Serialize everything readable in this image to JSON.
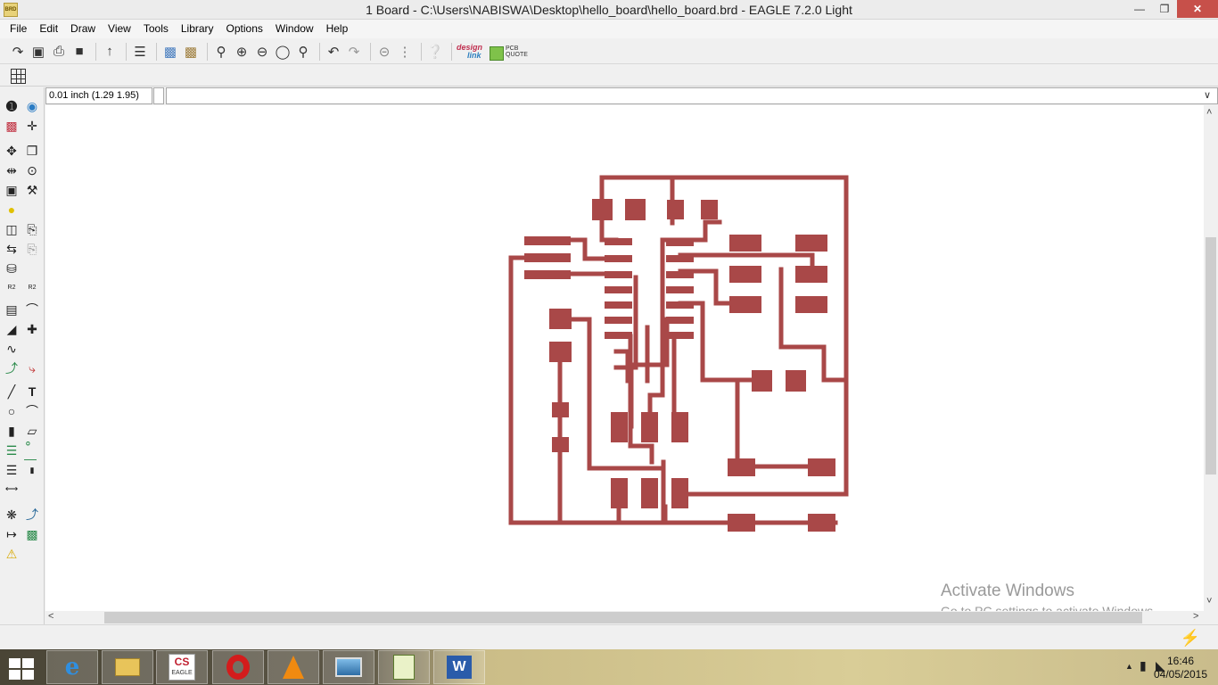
{
  "window": {
    "app_icon": "BRD",
    "title": "1 Board - C:\\Users\\NABISWA\\Desktop\\hello_board\\hello_board.brd - EAGLE 7.2.0 Light",
    "minimize": "minimize-icon",
    "restore": "restore-icon",
    "close": "close-icon"
  },
  "menu": {
    "items": [
      "File",
      "Edit",
      "Draw",
      "View",
      "Tools",
      "Library",
      "Options",
      "Window",
      "Help"
    ]
  },
  "toolbar": {
    "icons": [
      "open-icon",
      "save-icon",
      "print-icon",
      "cam-icon",
      "script-icon",
      "ulp-icon",
      "schematic-icon",
      "board-icon",
      "zoom-fit-icon",
      "zoom-in-icon",
      "zoom-out-icon",
      "zoom-redraw-icon",
      "zoom-select-icon",
      "undo-icon",
      "redo-icon",
      "stop-icon",
      "go-icon",
      "help-icon"
    ],
    "design_link_top": "design",
    "design_link_bottom": "link",
    "pcb_quote": "PCB QUOTE"
  },
  "coords": {
    "readout": "0.01 inch (1.29 1.95)",
    "command_value": "",
    "command_placeholder": ""
  },
  "left_tools": [
    "info-icon",
    "show-icon",
    "display-icon",
    "mark-icon",
    "move-icon",
    "copy-icon",
    "mirror-icon",
    "rotate-icon",
    "group-icon",
    "change-icon",
    "paste-icon",
    "delete-icon",
    "add-icon",
    "pinswap-icon",
    "replace-icon",
    "lock-icon",
    "name-icon",
    "value-icon",
    "smash-icon",
    "miter-icon",
    "split-icon",
    "optimize-icon",
    "meander-icon",
    "route-icon",
    "ripup-icon",
    "wire-icon",
    "text-icon",
    "circle-icon",
    "arc-icon",
    "rect-icon",
    "polygon-icon",
    "via-icon",
    "signal-icon",
    "hole-icon",
    "attribute-icon",
    "dimension-icon",
    "ratsnest-icon",
    "autoroute-icon",
    "drc-icon",
    "errors-icon",
    "warning-icon"
  ],
  "watermark": {
    "line1": "Activate Windows",
    "line2": "Go to PC settings to activate Windows."
  },
  "colors": {
    "copper": "#a94848",
    "canvas": "#ffffff"
  },
  "taskbar": {
    "apps": [
      "ie-icon",
      "file-explorer-icon",
      "eagle-icon",
      "opera-icon",
      "vlc-icon",
      "photos-icon",
      "notepad-icon",
      "word-icon"
    ],
    "eagle_label": "EAGLE",
    "time": "16:46",
    "date": "04/05/2015"
  }
}
